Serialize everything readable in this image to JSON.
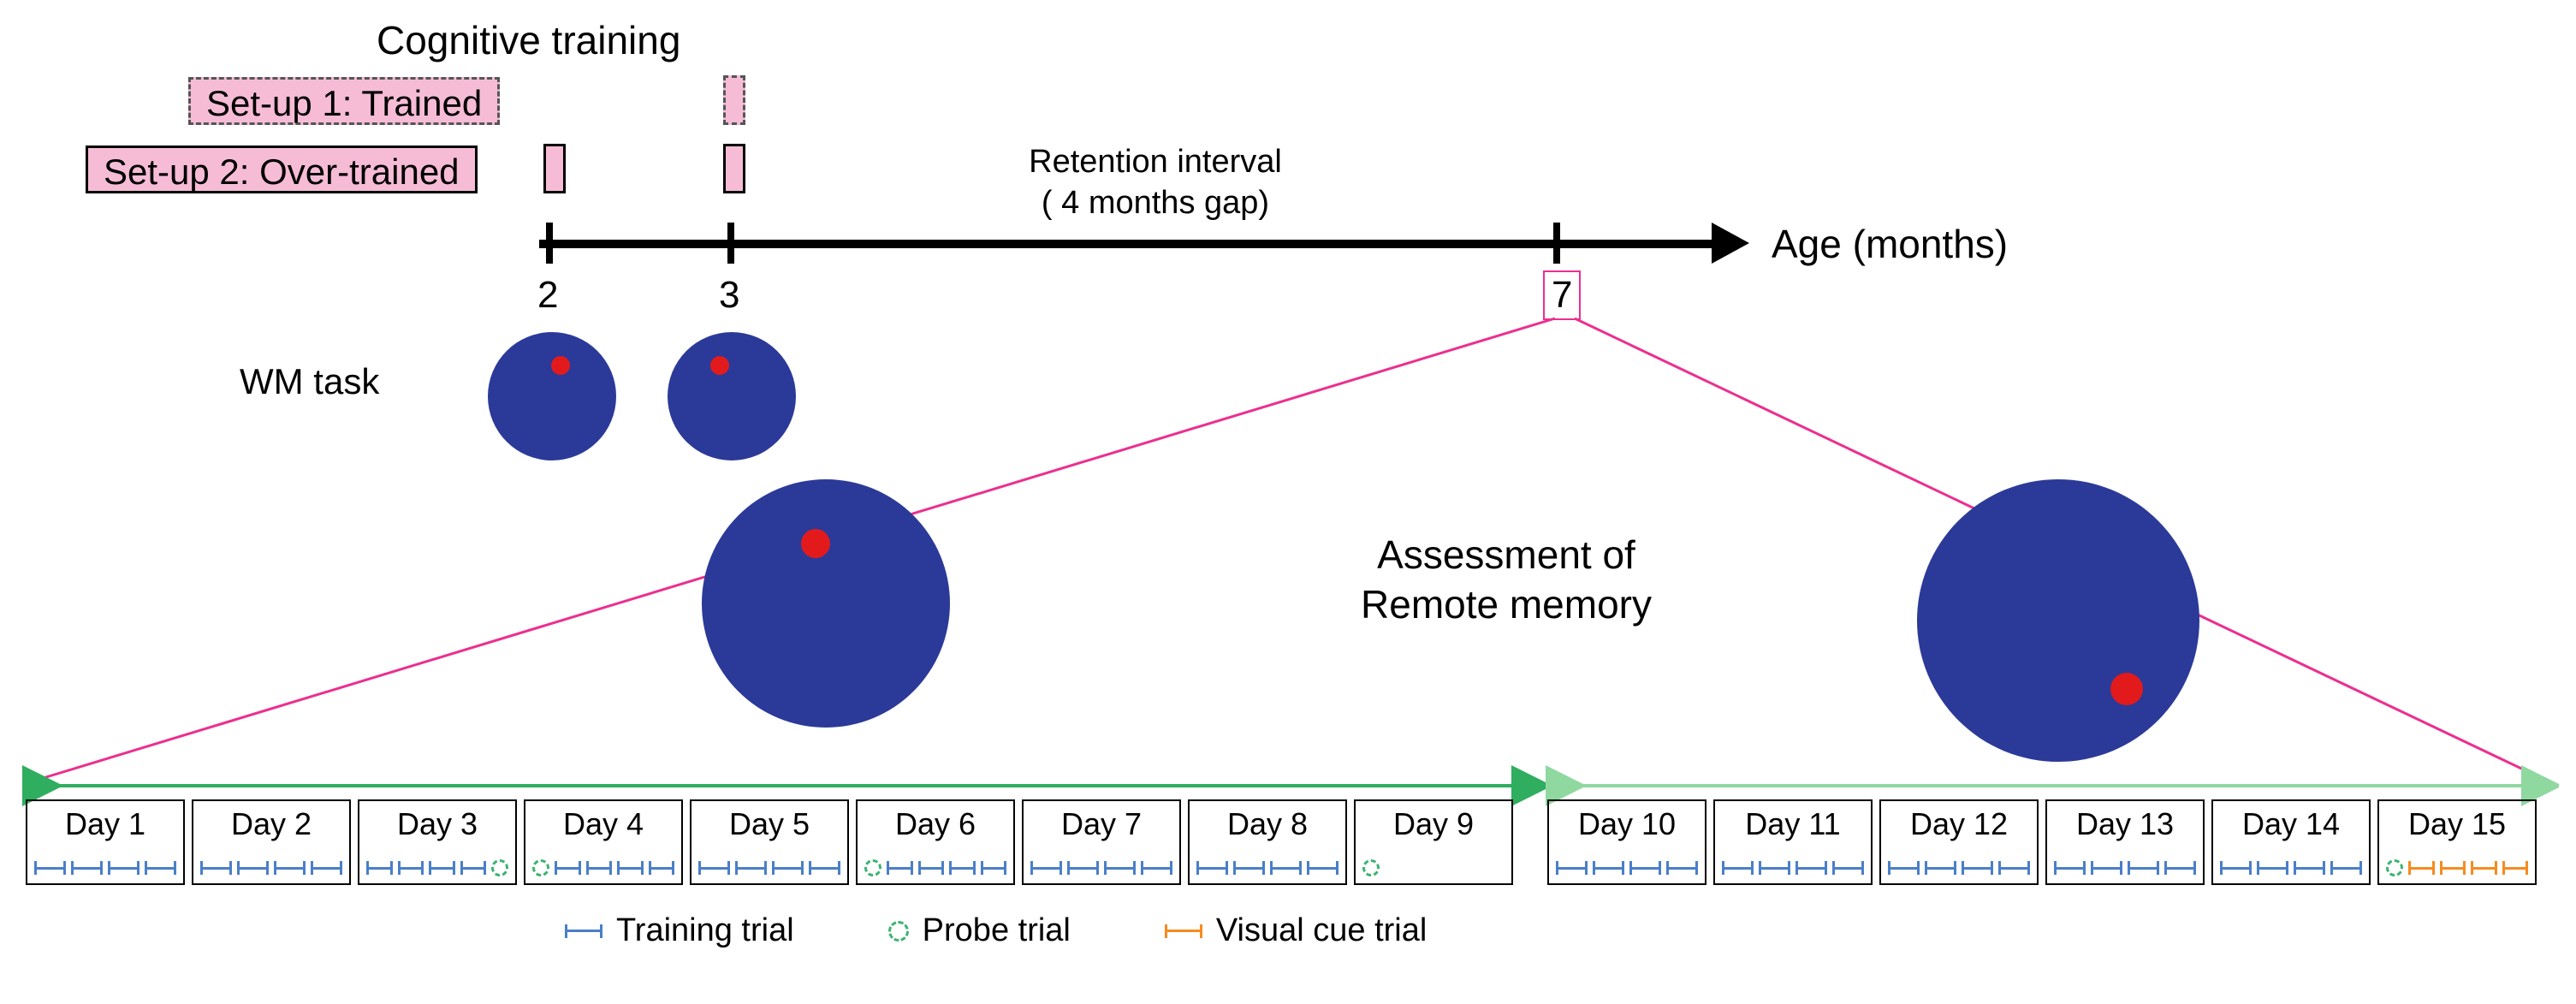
{
  "title": "Cognitive training",
  "setups": {
    "setup1": "Set-up 1: Trained",
    "setup2": "Set-up 2: Over-trained"
  },
  "axis": {
    "label": "Age (months)",
    "ticks": [
      "2",
      "3",
      "7"
    ],
    "retention": "Retention interval\n( 4 months gap)"
  },
  "wm_label": "WM task",
  "assessment": "Assessment of\nRemote memory",
  "days": [
    {
      "label": "Day 1",
      "trials": [
        "t",
        "t",
        "t",
        "t"
      ]
    },
    {
      "label": "Day 2",
      "trials": [
        "t",
        "t",
        "t",
        "t"
      ]
    },
    {
      "label": "Day 3",
      "trials": [
        "t",
        "t",
        "t",
        "t",
        "p"
      ]
    },
    {
      "label": "Day 4",
      "trials": [
        "p",
        "t",
        "t",
        "t",
        "t"
      ]
    },
    {
      "label": "Day 5",
      "trials": [
        "t",
        "t",
        "t",
        "t"
      ]
    },
    {
      "label": "Day 6",
      "trials": [
        "p",
        "t",
        "t",
        "t",
        "t"
      ]
    },
    {
      "label": "Day 7",
      "trials": [
        "t",
        "t",
        "t",
        "t"
      ]
    },
    {
      "label": "Day 8",
      "trials": [
        "t",
        "t",
        "t",
        "t"
      ]
    },
    {
      "label": "Day 9",
      "trials": [
        "p"
      ]
    },
    {
      "label": "Day 10",
      "trials": [
        "t",
        "t",
        "t",
        "t"
      ]
    },
    {
      "label": "Day 11",
      "trials": [
        "t",
        "t",
        "t",
        "t"
      ]
    },
    {
      "label": "Day 12",
      "trials": [
        "t",
        "t",
        "t",
        "t"
      ]
    },
    {
      "label": "Day 13",
      "trials": [
        "t",
        "t",
        "t",
        "t"
      ]
    },
    {
      "label": "Day 14",
      "trials": [
        "t",
        "t",
        "t",
        "t"
      ]
    },
    {
      "label": "Day 15",
      "trials": [
        "p",
        "v",
        "v",
        "v",
        "v"
      ]
    }
  ],
  "legend": {
    "training": "Training trial",
    "probe": "Probe trial",
    "visual": "Visual cue trial"
  },
  "colors": {
    "pink": "#f6bcd6",
    "magenta": "#ec2f8f",
    "blue_circle": "#2b3a98",
    "red_dot": "#e31a1c",
    "trial_blue": "#4a7fc8",
    "trial_orange": "#f68b1f",
    "probe_green": "#3cb371",
    "arrow_green_dark": "#2fae5f",
    "arrow_green_light": "#8fd89f"
  },
  "chart_data": {
    "type": "table",
    "description": "Experimental timeline diagram",
    "timeline_months": [
      2,
      3,
      7
    ],
    "setup1_training_at_months": [
      3
    ],
    "setup2_training_at_months": [
      2,
      3
    ],
    "retention_gap_months": 4,
    "remote_assessment_phase1_days": [
      1,
      2,
      3,
      4,
      5,
      6,
      7,
      8,
      9
    ],
    "remote_assessment_phase2_days": [
      10,
      11,
      12,
      13,
      14,
      15
    ],
    "trials_per_day": {
      "Day 1": {
        "training": 4
      },
      "Day 2": {
        "training": 4
      },
      "Day 3": {
        "training": 4,
        "probe": 1
      },
      "Day 4": {
        "probe": 1,
        "training": 4
      },
      "Day 5": {
        "training": 4
      },
      "Day 6": {
        "probe": 1,
        "training": 4
      },
      "Day 7": {
        "training": 4
      },
      "Day 8": {
        "training": 4
      },
      "Day 9": {
        "probe": 1
      },
      "Day 10": {
        "training": 4
      },
      "Day 11": {
        "training": 4
      },
      "Day 12": {
        "training": 4
      },
      "Day 13": {
        "training": 4
      },
      "Day 14": {
        "training": 4
      },
      "Day 15": {
        "probe": 1,
        "visual_cue": 4
      }
    }
  }
}
